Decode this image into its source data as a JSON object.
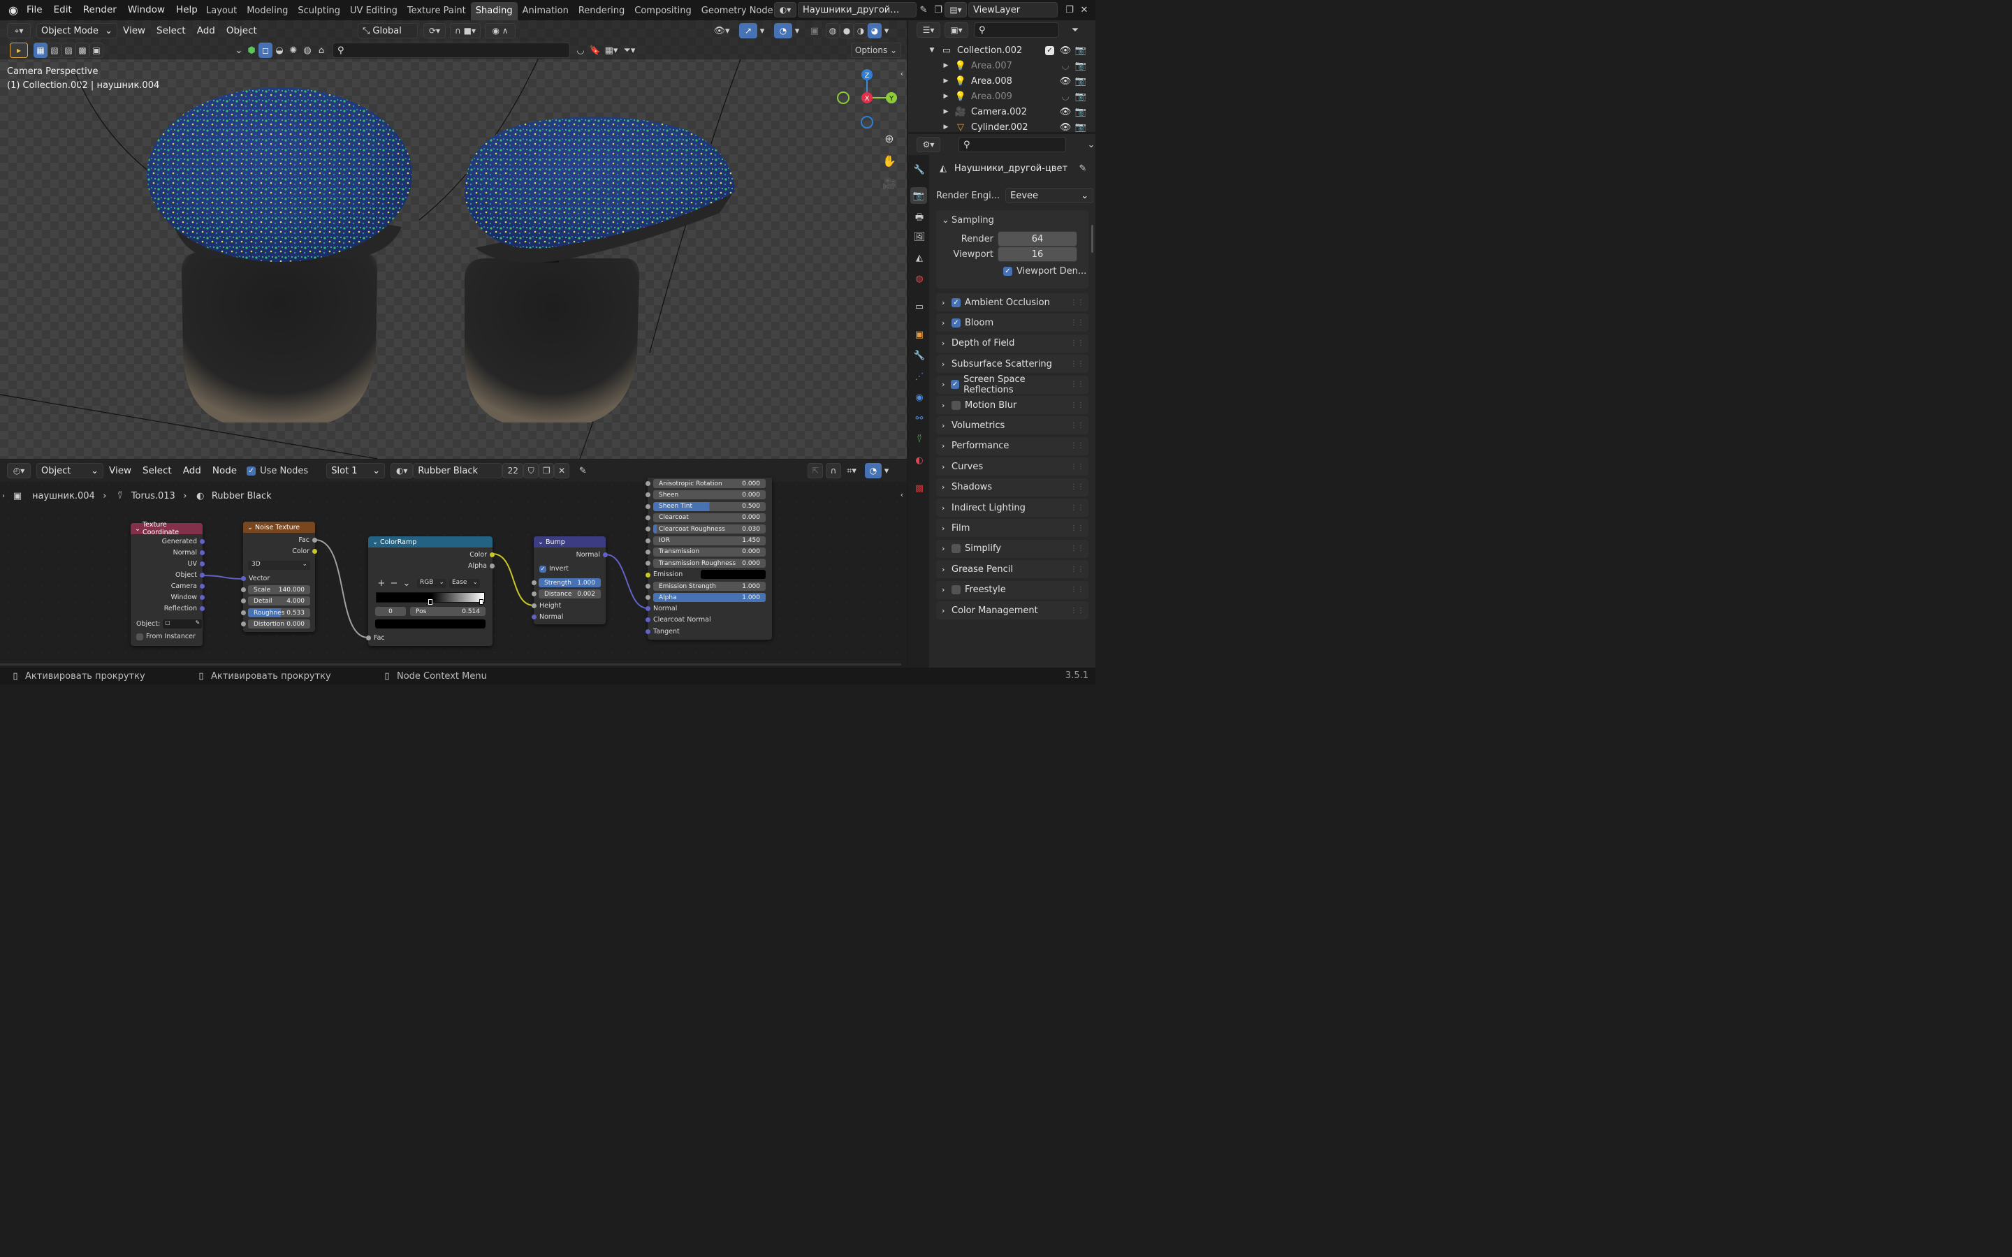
{
  "topbar": {
    "menus": [
      "File",
      "Edit",
      "Render",
      "Window",
      "Help"
    ],
    "workspaces": [
      "Layout",
      "Modeling",
      "Sculpting",
      "UV Editing",
      "Texture Paint",
      "Shading",
      "Animation",
      "Rendering",
      "Compositing",
      "Geometry Node"
    ],
    "active_workspace": "Shading",
    "scene_name": "Наушники_другой…",
    "view_layer": "ViewLayer"
  },
  "viewport": {
    "mode": "Object Mode",
    "menus": [
      "View",
      "Select",
      "Add",
      "Object"
    ],
    "orientation": "Global",
    "options_label": "Options",
    "camera_label": "Camera Perspective",
    "collection_label": "(1) Collection.002 | наушник.004",
    "gizmo": {
      "z": "Z",
      "y": "Y",
      "x": "X"
    }
  },
  "outliner": {
    "search_placeholder": "",
    "items": [
      {
        "name": "Collection.002",
        "level": 0
      },
      {
        "name": "Area.007",
        "level": 1,
        "dim": true
      },
      {
        "name": "Area.008",
        "level": 1,
        "dim": false
      },
      {
        "name": "Area.009",
        "level": 1,
        "dim": true
      },
      {
        "name": "Camera.002",
        "level": 1,
        "dim": false
      },
      {
        "name": "Cylinder.002",
        "level": 1,
        "dim": false
      }
    ]
  },
  "properties": {
    "scene_title": "Наушники_другой-цвет",
    "render_engine_label": "Render Engi...",
    "render_engine": "Eevee",
    "sampling": {
      "label": "Sampling",
      "render_label": "Render",
      "render_value": "64",
      "viewport_label": "Viewport",
      "viewport_value": "16",
      "denoise_label": "Viewport Den..."
    },
    "panels": [
      {
        "label": "Ambient Occlusion",
        "checkbox": "on"
      },
      {
        "label": "Bloom",
        "checkbox": "on"
      },
      {
        "label": "Depth of Field",
        "checkbox": "none"
      },
      {
        "label": "Subsurface Scattering",
        "checkbox": "none"
      },
      {
        "label": "Screen Space Reflections",
        "checkbox": "on"
      },
      {
        "label": "Motion Blur",
        "checkbox": "off"
      },
      {
        "label": "Volumetrics",
        "checkbox": "none"
      },
      {
        "label": "Performance",
        "checkbox": "none"
      },
      {
        "label": "Curves",
        "checkbox": "none"
      },
      {
        "label": "Shadows",
        "checkbox": "none"
      },
      {
        "label": "Indirect Lighting",
        "checkbox": "none"
      },
      {
        "label": "Film",
        "checkbox": "none"
      },
      {
        "label": "Simplify",
        "checkbox": "off"
      },
      {
        "label": "Grease Pencil",
        "checkbox": "none"
      },
      {
        "label": "Freestyle",
        "checkbox": "off"
      },
      {
        "label": "Color Management",
        "checkbox": "none"
      }
    ]
  },
  "node_editor": {
    "mode": "Object",
    "menus": [
      "View",
      "Select",
      "Add",
      "Node"
    ],
    "use_nodes_label": "Use Nodes",
    "slot": "Slot 1",
    "material": "Rubber Black",
    "users": "22",
    "breadcrumb": [
      "наушник.004",
      "Torus.013",
      "Rubber Black"
    ],
    "texcoord": {
      "title": "Texture Coordinate",
      "outputs": [
        "Generated",
        "Normal",
        "UV",
        "Object",
        "Camera",
        "Window",
        "Reflection"
      ],
      "object_label": "Object:",
      "instancer_label": "From Instancer"
    },
    "noise": {
      "title": "Noise Texture",
      "outputs": [
        "Fac",
        "Color"
      ],
      "dimension": "3D",
      "vector_label": "Vector",
      "fields": [
        {
          "label": "Scale",
          "value": "140.000"
        },
        {
          "label": "Detail",
          "value": "4.000"
        },
        {
          "label": "Roughnes",
          "value": "0.533"
        },
        {
          "label": "Distortion",
          "value": "0.000"
        }
      ]
    },
    "colorramp": {
      "title": "ColorRamp",
      "outputs": [
        "Color",
        "Alpha"
      ],
      "mode": "RGB",
      "interp": "Ease",
      "index": "0",
      "pos_label": "Pos",
      "pos_value": "0.514",
      "fac_label": "Fac"
    },
    "bump": {
      "title": "Bump",
      "output": "Normal",
      "invert_label": "Invert",
      "strength_label": "Strength",
      "strength_value": "1.000",
      "distance_label": "Distance",
      "distance_value": "0.002",
      "height_label": "Height",
      "normal_label": "Normal"
    },
    "bsdf": {
      "fields": [
        {
          "label": "Anisotropic Rotation",
          "value": "0.000",
          "fill": 0
        },
        {
          "label": "Sheen",
          "value": "0.000",
          "fill": 0
        },
        {
          "label": "Sheen Tint",
          "value": "0.500",
          "fill": 0.5
        },
        {
          "label": "Clearcoat",
          "value": "0.000",
          "fill": 0
        },
        {
          "label": "Clearcoat Roughness",
          "value": "0.030",
          "fill": 0.03
        },
        {
          "label": "IOR",
          "value": "1.450",
          "fill": 0
        },
        {
          "label": "Transmission",
          "value": "0.000",
          "fill": 0
        },
        {
          "label": "Transmission Roughness",
          "value": "0.000",
          "fill": 0
        }
      ],
      "emission_label": "Emission",
      "emission_strength_label": "Emission Strength",
      "emission_strength_value": "1.000",
      "alpha_label": "Alpha",
      "alpha_value": "1.000",
      "inputs": [
        "Normal",
        "Clearcoat Normal",
        "Tangent"
      ]
    }
  },
  "statusbar": {
    "items": [
      "Активировать прокрутку",
      "Активировать прокрутку",
      "Node Context Menu"
    ],
    "version": "3.5.1"
  },
  "colors": {
    "accent": "#4772b3",
    "texcoord_head": "#83314a",
    "noise_head": "#79461d",
    "ramp_head": "#246283",
    "bump_head": "#3c3c83"
  }
}
